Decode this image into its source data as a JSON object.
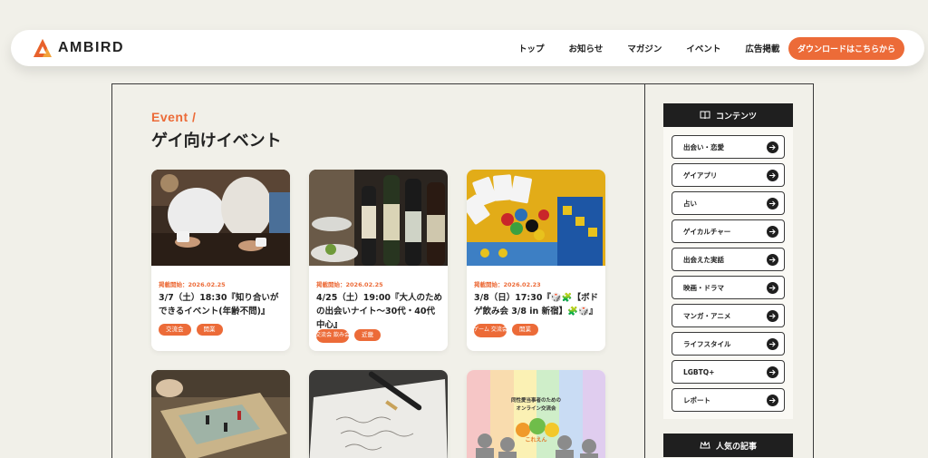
{
  "header": {
    "brand": "AMBIRD",
    "nav": [
      "トップ",
      "お知らせ",
      "マガジン",
      "イベント",
      "広告掲載"
    ],
    "download_label": "ダウンロードはこちらから"
  },
  "section": {
    "eyebrow": "Event /",
    "title": "ゲイ向けイベント"
  },
  "cards": [
    {
      "date": "掲載開始：2026.02.25",
      "title": "3/7（土）18:30『知り合いができるイベント(年齢不問)』",
      "tags": [
        "交流会",
        "開業"
      ]
    },
    {
      "date": "掲載開始：2026.02.25",
      "title": "4/25（土）19:00『大人のための出会いナイト〜30代・40代中心』",
      "tags": [
        "交流会 飲み会",
        "近畿"
      ]
    },
    {
      "date": "掲載開始：2026.02.23",
      "title": "3/8（日）17:30『🎲🧩【ボドゲ飲み会 3/8 in 新宿】🧩🎲』",
      "tags": [
        "ゲーム 交流会",
        "開業"
      ]
    },
    {
      "date": "",
      "title": "",
      "tags": []
    },
    {
      "date": "",
      "title": "",
      "tags": []
    },
    {
      "date": "",
      "title": "",
      "tags": []
    }
  ],
  "card6_overlay": {
    "line1": "同性愛当事者のための",
    "line2": "オンライン交流会",
    "logo": "これえん"
  },
  "sidebar": {
    "heading": "コンテンツ",
    "items": [
      "出会い・恋愛",
      "ゲイアプリ",
      "占い",
      "ゲイカルチャー",
      "出会えた実話",
      "映画・ドラマ",
      "マンガ・アニメ",
      "ライフスタイル",
      "LGBTQ+",
      "レポート"
    ],
    "heading2": "人気の記事"
  },
  "colors": {
    "accent": "#ec6b38",
    "dark": "#1f1f1f",
    "background": "#f1f0e9"
  }
}
